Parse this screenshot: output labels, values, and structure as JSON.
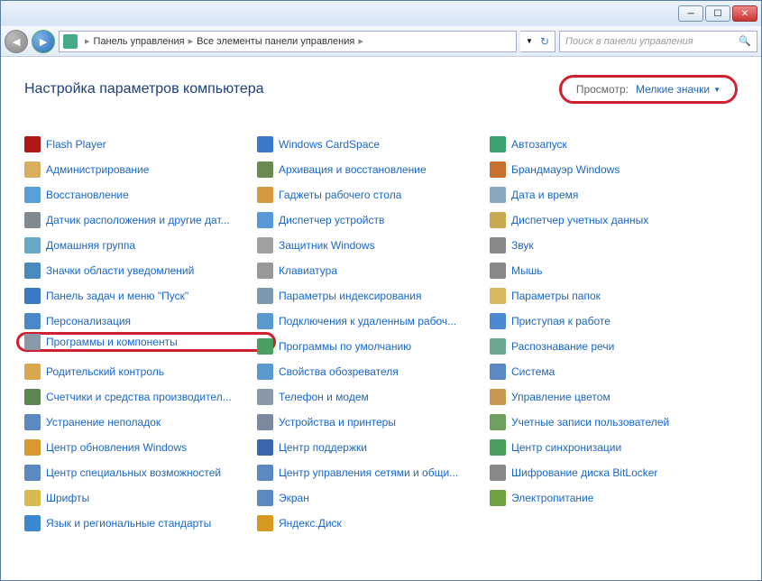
{
  "breadcrumb": {
    "level1": "Панель управления",
    "level2": "Все элементы панели управления"
  },
  "search": {
    "placeholder": "Поиск в панели управления"
  },
  "page_title": "Настройка параметров компьютера",
  "view": {
    "label": "Просмотр:",
    "value": "Мелкие значки"
  },
  "items": [
    {
      "label": "Flash Player",
      "icon": "#b01818",
      "highlight": false
    },
    {
      "label": "Windows CardSpace",
      "icon": "#3a78c8",
      "highlight": false
    },
    {
      "label": "Автозапуск",
      "icon": "#3aa070",
      "highlight": false
    },
    {
      "label": "Администрирование",
      "icon": "#d8b060",
      "highlight": false
    },
    {
      "label": "Архивация и восстановление",
      "icon": "#6a8a50",
      "highlight": false
    },
    {
      "label": "Брандмауэр Windows",
      "icon": "#c87030",
      "highlight": false
    },
    {
      "label": "Восстановление",
      "icon": "#5aa0d8",
      "highlight": false
    },
    {
      "label": "Гаджеты рабочего стола",
      "icon": "#d89a40",
      "highlight": false
    },
    {
      "label": "Дата и время",
      "icon": "#8aa8c0",
      "highlight": false
    },
    {
      "label": "Датчик расположения и другие дат...",
      "icon": "#808890",
      "highlight": false
    },
    {
      "label": "Диспетчер устройств",
      "icon": "#5898d8",
      "highlight": false
    },
    {
      "label": "Диспетчер учетных данных",
      "icon": "#c8a850",
      "highlight": false
    },
    {
      "label": "Домашняя группа",
      "icon": "#6aa8c8",
      "highlight": false
    },
    {
      "label": "Защитник Windows",
      "icon": "#a0a0a0",
      "highlight": false
    },
    {
      "label": "Звук",
      "icon": "#888888",
      "highlight": false
    },
    {
      "label": "Значки области уведомлений",
      "icon": "#4a88c0",
      "highlight": false
    },
    {
      "label": "Клавиатура",
      "icon": "#999999",
      "highlight": false
    },
    {
      "label": "Мышь",
      "icon": "#888888",
      "highlight": false
    },
    {
      "label": "Панель задач и меню \"Пуск\"",
      "icon": "#3a78c8",
      "highlight": false
    },
    {
      "label": "Параметры индексирования",
      "icon": "#7a98b0",
      "highlight": false
    },
    {
      "label": "Параметры папок",
      "icon": "#d8b860",
      "highlight": false
    },
    {
      "label": "Персонализация",
      "icon": "#4a88c8",
      "highlight": false
    },
    {
      "label": "Подключения к удаленным рабоч...",
      "icon": "#5a98d0",
      "highlight": false
    },
    {
      "label": "Приступая к работе",
      "icon": "#4a88d0",
      "highlight": false
    },
    {
      "label": "Программы и компоненты",
      "icon": "#8a98a8",
      "highlight": true
    },
    {
      "label": "Программы по умолчанию",
      "icon": "#4aa060",
      "highlight": false
    },
    {
      "label": "Распознавание речи",
      "icon": "#6aa890",
      "highlight": false
    },
    {
      "label": "Родительский контроль",
      "icon": "#d8a850",
      "highlight": false
    },
    {
      "label": "Свойства обозревателя",
      "icon": "#5a98d0",
      "highlight": false
    },
    {
      "label": "Система",
      "icon": "#5a88c0",
      "highlight": false
    },
    {
      "label": "Счетчики и средства производител...",
      "icon": "#5a8850",
      "highlight": false
    },
    {
      "label": "Телефон и модем",
      "icon": "#8898a8",
      "highlight": false
    },
    {
      "label": "Управление цветом",
      "icon": "#c89850",
      "highlight": false
    },
    {
      "label": "Устранение неполадок",
      "icon": "#5a88c0",
      "highlight": false
    },
    {
      "label": "Устройства и принтеры",
      "icon": "#7a88a0",
      "highlight": false
    },
    {
      "label": "Учетные записи пользователей",
      "icon": "#70a060",
      "highlight": false
    },
    {
      "label": "Центр обновления Windows",
      "icon": "#d89830",
      "highlight": false
    },
    {
      "label": "Центр поддержки",
      "icon": "#3a68b0",
      "highlight": false
    },
    {
      "label": "Центр синхронизации",
      "icon": "#4aa060",
      "highlight": false
    },
    {
      "label": "Центр специальных возможностей",
      "icon": "#5a88c0",
      "highlight": false
    },
    {
      "label": "Центр управления сетями и общи...",
      "icon": "#5a88c0",
      "highlight": false
    },
    {
      "label": "Шифрование диска BitLocker",
      "icon": "#888888",
      "highlight": false
    },
    {
      "label": "Шрифты",
      "icon": "#d8b850",
      "highlight": false
    },
    {
      "label": "Экран",
      "icon": "#5a88c0",
      "highlight": false
    },
    {
      "label": "Электропитание",
      "icon": "#70a040",
      "highlight": false
    },
    {
      "label": "Язык и региональные стандарты",
      "icon": "#3a88d0",
      "highlight": false
    },
    {
      "label": "Яндекс.Диск",
      "icon": "#d89820",
      "highlight": false
    }
  ]
}
